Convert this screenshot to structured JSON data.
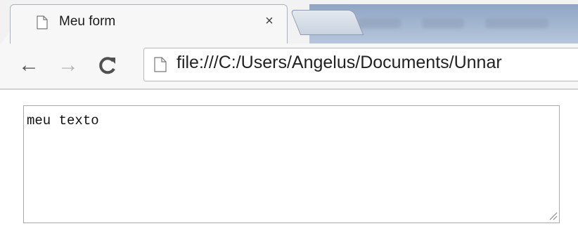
{
  "tab": {
    "title": "Meu form",
    "close_glyph": "×",
    "icon": "page-icon"
  },
  "toolbar": {
    "back_glyph": "←",
    "forward_glyph": "→",
    "reload_glyph": "C",
    "url": "file:///C:/Users/Angelus/Documents/Unnar",
    "url_icon": "page-icon"
  },
  "content": {
    "textarea_value": "meu texto"
  }
}
